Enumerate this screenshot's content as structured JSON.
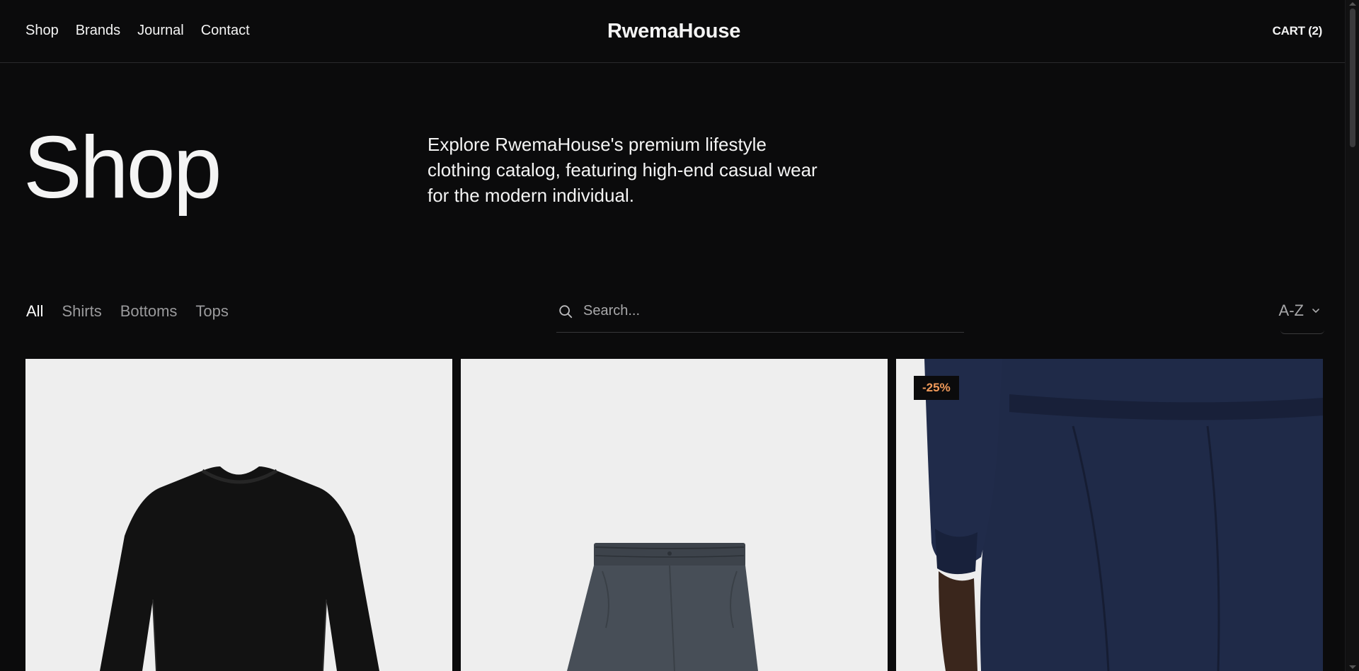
{
  "header": {
    "nav": [
      "Shop",
      "Brands",
      "Journal",
      "Contact"
    ],
    "logo": "RwemaHouse",
    "cart": "CART (2)"
  },
  "hero": {
    "title": "Shop",
    "description": "Explore RwemaHouse's premium lifestyle clothing catalog, featuring high-end casual wear for the modern individual."
  },
  "filters": {
    "categories": [
      "All",
      "Shirts",
      "Bottoms",
      "Tops"
    ],
    "active": "All"
  },
  "search": {
    "placeholder": "Search..."
  },
  "sort": {
    "value": "A-Z"
  },
  "products": [
    {
      "image": "black-sweatshirt-image",
      "badge": ""
    },
    {
      "image": "grey-shorts-image",
      "badge": ""
    },
    {
      "image": "navy-sweatpants-image",
      "badge": "-25%"
    }
  ],
  "colors": {
    "background": "#0b0b0c",
    "badge_text": "#f19a5a",
    "card_bg": "#eeeeee"
  }
}
